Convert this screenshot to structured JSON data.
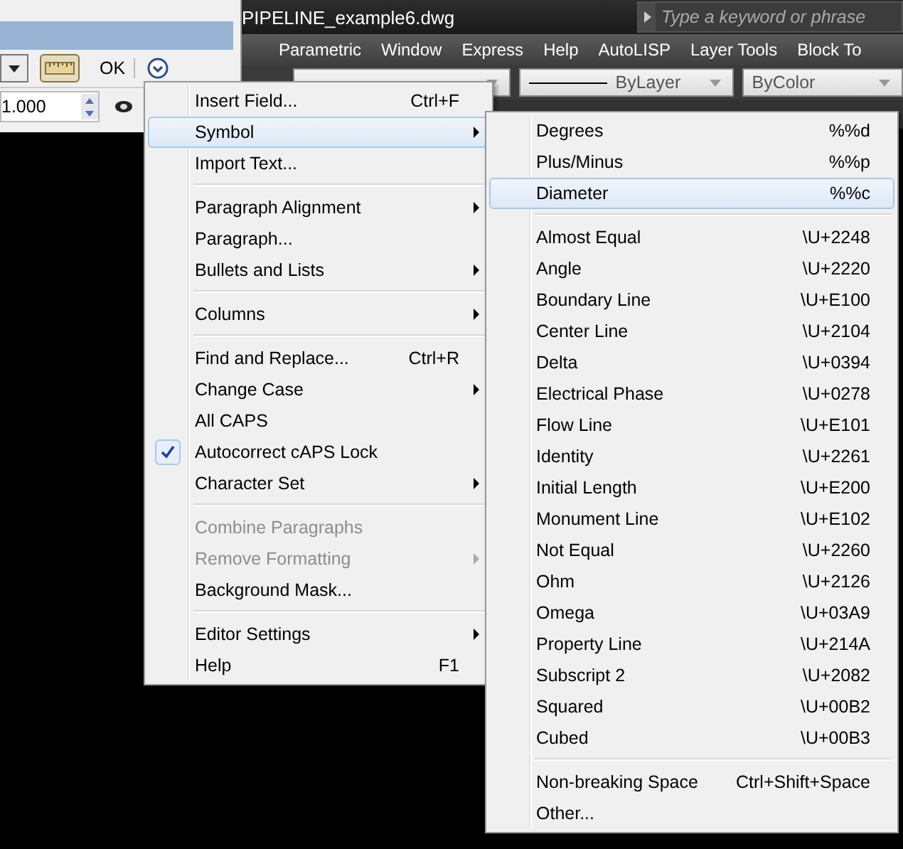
{
  "app": {
    "title": "PIPELINE_example6.dwg",
    "search": {
      "placeholder": "Type a keyword or phrase"
    },
    "menu_bar": [
      "Parametric",
      "Window",
      "Express",
      "Help",
      "AutoLISP",
      "Layer Tools",
      "Block To"
    ],
    "toolbar": {
      "linetype": "ByLayer",
      "plot_style": "ByColor"
    }
  },
  "editor_toolbar": {
    "ok": "OK",
    "spacing": "1.000"
  },
  "context_menu": [
    {
      "kind": "item",
      "label": "Insert Field...",
      "shortcut": "Ctrl+F",
      "submenu": false,
      "checked": false,
      "disabled": false,
      "selected": false
    },
    {
      "kind": "item",
      "label": "Symbol",
      "submenu": true,
      "checked": false,
      "disabled": false,
      "selected": true
    },
    {
      "kind": "item",
      "label": "Import Text...",
      "submenu": false,
      "checked": false,
      "disabled": false,
      "selected": false
    },
    {
      "kind": "separator"
    },
    {
      "kind": "item",
      "label": "Paragraph Alignment",
      "submenu": true,
      "checked": false,
      "disabled": false,
      "selected": false
    },
    {
      "kind": "item",
      "label": "Paragraph...",
      "submenu": false,
      "checked": false,
      "disabled": false,
      "selected": false
    },
    {
      "kind": "item",
      "label": "Bullets and Lists",
      "submenu": true,
      "checked": false,
      "disabled": false,
      "selected": false
    },
    {
      "kind": "separator"
    },
    {
      "kind": "item",
      "label": "Columns",
      "submenu": true,
      "checked": false,
      "disabled": false,
      "selected": false
    },
    {
      "kind": "separator"
    },
    {
      "kind": "item",
      "label": "Find and Replace...",
      "shortcut": "Ctrl+R",
      "submenu": false,
      "checked": false,
      "disabled": false,
      "selected": false
    },
    {
      "kind": "item",
      "label": "Change Case",
      "submenu": true,
      "checked": false,
      "disabled": false,
      "selected": false
    },
    {
      "kind": "item",
      "label": "All CAPS",
      "submenu": false,
      "checked": false,
      "disabled": false,
      "selected": false
    },
    {
      "kind": "item",
      "label": "Autocorrect cAPS Lock",
      "submenu": false,
      "checked": true,
      "disabled": false,
      "selected": false
    },
    {
      "kind": "item",
      "label": "Character Set",
      "submenu": true,
      "checked": false,
      "disabled": false,
      "selected": false
    },
    {
      "kind": "separator"
    },
    {
      "kind": "item",
      "label": "Combine Paragraphs",
      "submenu": false,
      "checked": false,
      "disabled": true,
      "selected": false
    },
    {
      "kind": "item",
      "label": "Remove Formatting",
      "submenu": true,
      "checked": false,
      "disabled": true,
      "selected": false
    },
    {
      "kind": "item",
      "label": "Background Mask...",
      "submenu": false,
      "checked": false,
      "disabled": false,
      "selected": false
    },
    {
      "kind": "separator"
    },
    {
      "kind": "item",
      "label": "Editor Settings",
      "submenu": true,
      "checked": false,
      "disabled": false,
      "selected": false
    },
    {
      "kind": "item",
      "label": "Help",
      "shortcut": "F1",
      "submenu": false,
      "checked": false,
      "disabled": false,
      "selected": false
    }
  ],
  "symbol_menu": [
    {
      "kind": "item",
      "label": "Degrees",
      "shortcut": "%%d",
      "selected": false
    },
    {
      "kind": "item",
      "label": "Plus/Minus",
      "shortcut": "%%p",
      "selected": false
    },
    {
      "kind": "item",
      "label": "Diameter",
      "shortcut": "%%c",
      "selected": true
    },
    {
      "kind": "separator"
    },
    {
      "kind": "item",
      "label": "Almost Equal",
      "shortcut": "\\U+2248",
      "selected": false
    },
    {
      "kind": "item",
      "label": "Angle",
      "shortcut": "\\U+2220",
      "selected": false
    },
    {
      "kind": "item",
      "label": "Boundary Line",
      "shortcut": "\\U+E100",
      "selected": false
    },
    {
      "kind": "item",
      "label": "Center Line",
      "shortcut": "\\U+2104",
      "selected": false
    },
    {
      "kind": "item",
      "label": "Delta",
      "shortcut": "\\U+0394",
      "selected": false
    },
    {
      "kind": "item",
      "label": "Electrical Phase",
      "shortcut": "\\U+0278",
      "selected": false
    },
    {
      "kind": "item",
      "label": "Flow Line",
      "shortcut": "\\U+E101",
      "selected": false
    },
    {
      "kind": "item",
      "label": "Identity",
      "shortcut": "\\U+2261",
      "selected": false
    },
    {
      "kind": "item",
      "label": "Initial Length",
      "shortcut": "\\U+E200",
      "selected": false
    },
    {
      "kind": "item",
      "label": "Monument Line",
      "shortcut": "\\U+E102",
      "selected": false
    },
    {
      "kind": "item",
      "label": "Not Equal",
      "shortcut": "\\U+2260",
      "selected": false
    },
    {
      "kind": "item",
      "label": "Ohm",
      "shortcut": "\\U+2126",
      "selected": false
    },
    {
      "kind": "item",
      "label": "Omega",
      "shortcut": "\\U+03A9",
      "selected": false
    },
    {
      "kind": "item",
      "label": "Property Line",
      "shortcut": "\\U+214A",
      "selected": false
    },
    {
      "kind": "item",
      "label": "Subscript 2",
      "shortcut": "\\U+2082",
      "selected": false
    },
    {
      "kind": "item",
      "label": "Squared",
      "shortcut": "\\U+00B2",
      "selected": false
    },
    {
      "kind": "item",
      "label": "Cubed",
      "shortcut": "\\U+00B3",
      "selected": false
    },
    {
      "kind": "separator"
    },
    {
      "kind": "item",
      "label": "Non-breaking Space",
      "shortcut": "Ctrl+Shift+Space",
      "selected": false
    },
    {
      "kind": "item",
      "label": "Other...",
      "selected": false
    }
  ]
}
